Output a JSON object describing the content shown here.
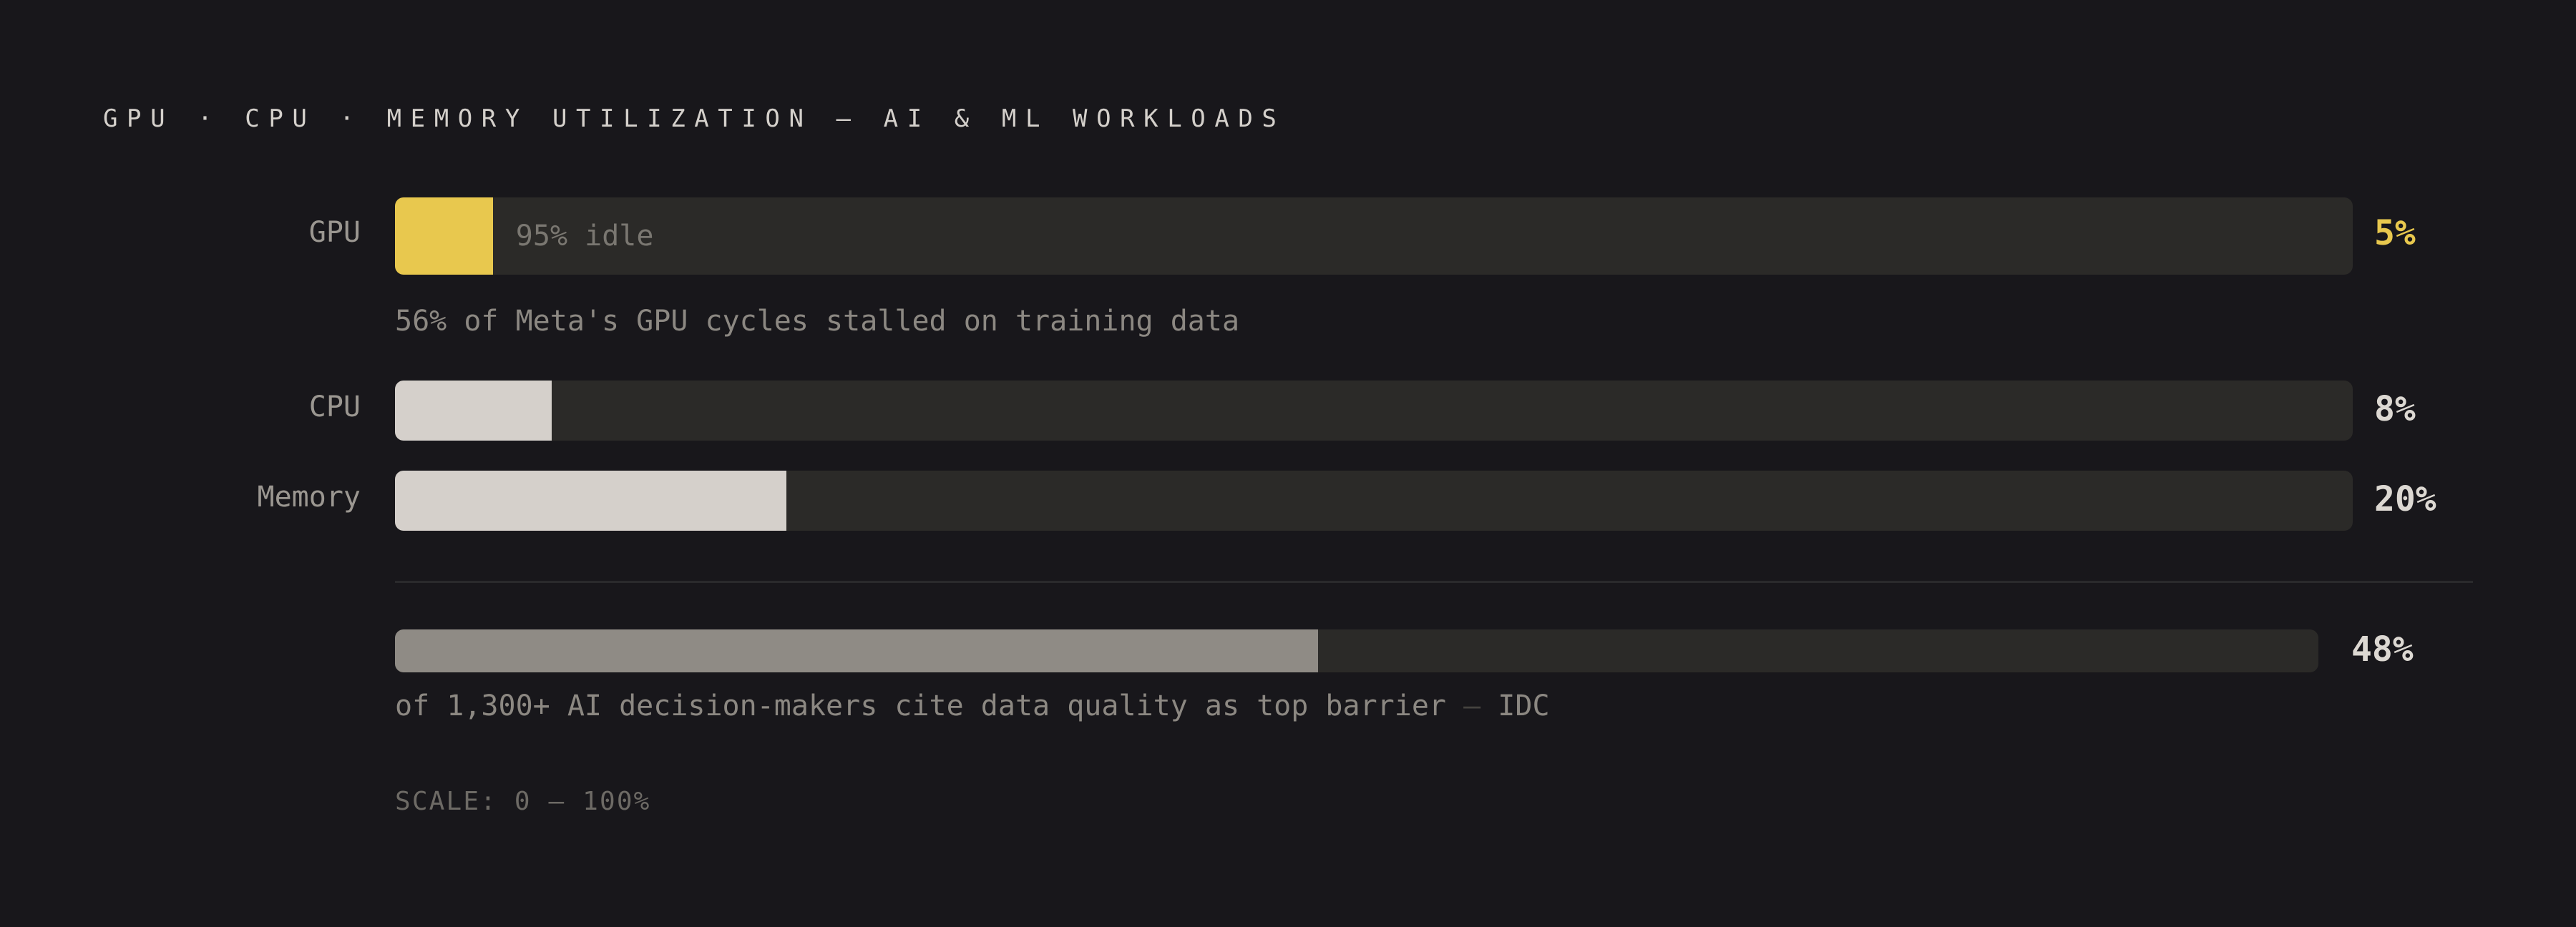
{
  "title": "GPU · CPU · MEMORY UTILIZATION — AI & ML WORKLOADS",
  "chart_data": {
    "type": "bar",
    "orientation": "horizontal",
    "title": "GPU · CPU · MEMORY UTILIZATION — AI & ML WORKLOADS",
    "categories": [
      "GPU",
      "CPU",
      "Memory"
    ],
    "values": [
      5,
      8,
      20
    ],
    "value_labels": [
      "5%",
      "8%",
      "20%"
    ],
    "xlim": [
      0,
      100
    ],
    "gpu_idle_label": "95% idle",
    "gpu_note": "56% of Meta's GPU cycles stalled on training data",
    "stat": {
      "value": 48,
      "value_label": "48%",
      "note_text": "of 1,300+ AI decision-makers cite data quality as top barrier",
      "note_dash": "—",
      "note_source": "IDC"
    },
    "scale_label": "SCALE: 0 — 100%",
    "colors": {
      "background": "#18171b",
      "track": "#2b2a28",
      "gpu_fill": "#e8c84e",
      "neutral_fill": "#d5d0cb",
      "stat_fill": "#8f8b85",
      "gpu_value": "#e8c84e",
      "neutral_value": "#dcd8d2"
    }
  }
}
